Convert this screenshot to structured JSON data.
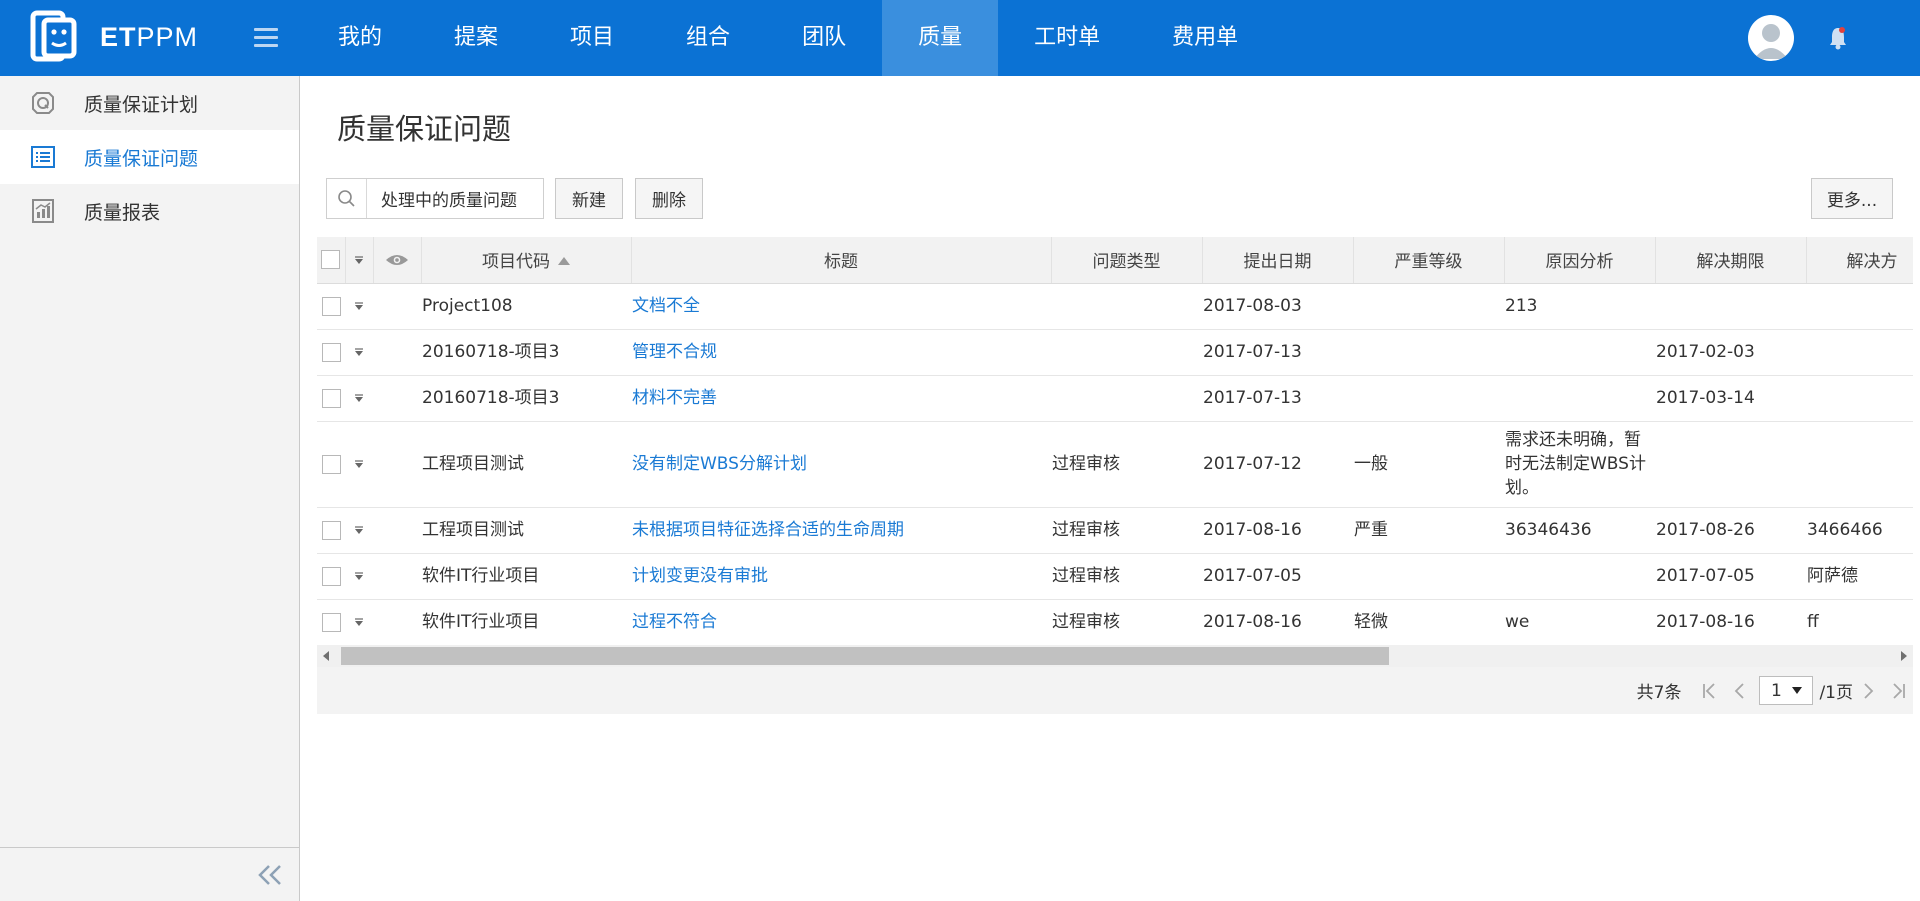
{
  "app": {
    "brand_bold": "ET",
    "brand_rest": "PPM"
  },
  "nav": {
    "items": [
      {
        "label": "我的"
      },
      {
        "label": "提案"
      },
      {
        "label": "项目"
      },
      {
        "label": "组合"
      },
      {
        "label": "团队"
      },
      {
        "label": "质量",
        "active": true
      },
      {
        "label": "工时单"
      },
      {
        "label": "费用单"
      }
    ]
  },
  "sidebar": {
    "items": [
      {
        "label": "质量保证计划",
        "icon": "q-badge-icon"
      },
      {
        "label": "质量保证问题",
        "icon": "list-icon",
        "active": true
      },
      {
        "label": "质量报表",
        "icon": "report-chart-icon"
      }
    ]
  },
  "page": {
    "title": "质量保证问题"
  },
  "toolbar": {
    "search_text": "处理中的质量问题",
    "new_label": "新建",
    "delete_label": "删除",
    "more_label": "更多..."
  },
  "table": {
    "headers": {
      "code": "项目代码",
      "title": "标题",
      "type": "问题类型",
      "date": "提出日期",
      "severity": "严重等级",
      "cause": "原因分析",
      "deadline": "解决期限",
      "solution": "解决方"
    },
    "rows": [
      {
        "code": "Project108",
        "title": "文档不全",
        "type": "",
        "date": "2017-08-03",
        "severity": "",
        "cause": "213",
        "deadline": "",
        "solution": ""
      },
      {
        "code": "20160718-项目3",
        "title": "管理不合规",
        "type": "",
        "date": "2017-07-13",
        "severity": "",
        "cause": "",
        "deadline": "2017-02-03",
        "solution": ""
      },
      {
        "code": "20160718-项目3",
        "title": "材料不完善",
        "type": "",
        "date": "2017-07-13",
        "severity": "",
        "cause": "",
        "deadline": "2017-03-14",
        "solution": ""
      },
      {
        "code": "工程项目测试",
        "title": "没有制定WBS分解计划",
        "type": "过程审核",
        "date": "2017-07-12",
        "severity": "一般",
        "cause": "需求还未明确，暂时无法制定WBS计划。",
        "deadline": "",
        "solution": ""
      },
      {
        "code": "工程项目测试",
        "title": "未根据项目特征选择合适的生命周期",
        "type": "过程审核",
        "date": "2017-08-16",
        "severity": "严重",
        "cause": "36346436",
        "deadline": "2017-08-26",
        "solution": "3466466"
      },
      {
        "code": "软件IT行业项目",
        "title": "计划变更没有审批",
        "type": "过程审核",
        "date": "2017-07-05",
        "severity": "",
        "cause": "",
        "deadline": "2017-07-05",
        "solution": "阿萨德"
      },
      {
        "code": "软件IT行业项目",
        "title": "过程不符合",
        "type": "过程审核",
        "date": "2017-08-16",
        "severity": "轻微",
        "cause": "we",
        "deadline": "2017-08-16",
        "solution": "ff"
      }
    ]
  },
  "pager": {
    "total": "共7条",
    "page": "1",
    "pages": "/1页"
  },
  "colors": {
    "topbar": "#0b72d4",
    "nav_active": "#3a8fde",
    "link": "#1a7ad4",
    "sidebar_bg": "#f3f3f3"
  }
}
